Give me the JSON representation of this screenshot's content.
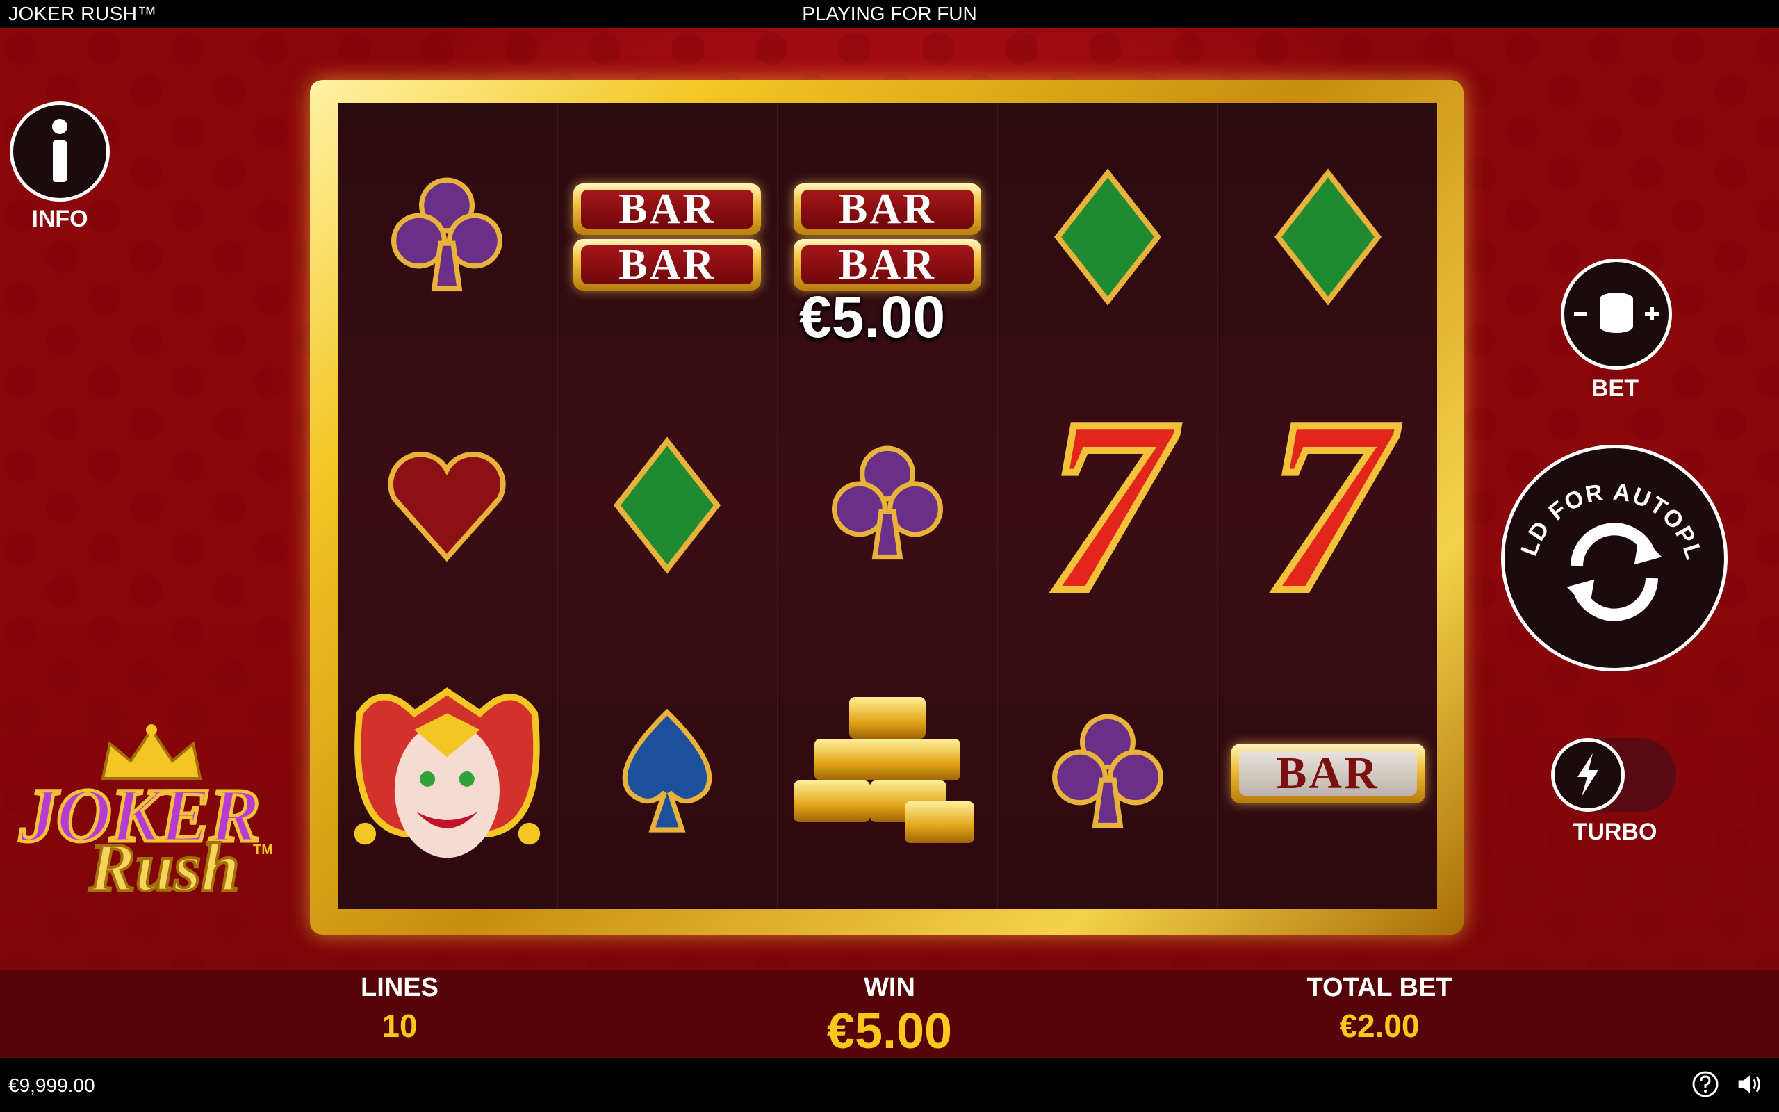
{
  "header": {
    "game_title": "JOKER RUSH™",
    "mode": "PLAYING FOR FUN"
  },
  "reels": [
    [
      "club",
      "heart",
      "joker"
    ],
    [
      "bar-double",
      "diamond",
      "spade"
    ],
    [
      "bar-double",
      "club",
      "gold-bars"
    ],
    [
      "diamond",
      "seven",
      "club"
    ],
    [
      "diamond",
      "seven",
      "bar"
    ]
  ],
  "symbols": {
    "bar_text": "BAR",
    "seven_text": "7"
  },
  "reel_win": "€5.00",
  "buttons": {
    "info_label": "INFO",
    "bet_label": "BET",
    "autoplay_text": "HOLD FOR AUTOPLAY",
    "turbo_label": "TURBO"
  },
  "logo": {
    "line1": "JOKER",
    "line2": "Rush",
    "tm": "TM"
  },
  "stats": {
    "lines_label": "LINES",
    "lines_value": "10",
    "win_label": "WIN",
    "win_value": "€5.00",
    "total_bet_label": "TOTAL BET",
    "total_bet_value": "€2.00"
  },
  "footer": {
    "balance": "€9,999.00"
  },
  "colors": {
    "accent_gold": "#f8c81c",
    "background_red": "#b00d12",
    "frame_gold": "#f3c623"
  }
}
